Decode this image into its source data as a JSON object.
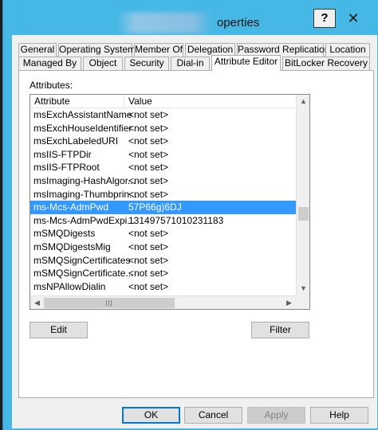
{
  "window": {
    "title_visible": "operties"
  },
  "tabs_row1": [
    "General",
    "Operating System",
    "Member Of",
    "Delegation",
    "Password Replication",
    "Location"
  ],
  "tabs_row2": [
    "Managed By",
    "Object",
    "Security",
    "Dial-in",
    "Attribute Editor",
    "BitLocker Recovery"
  ],
  "attributes_label": "Attributes:",
  "columns": {
    "attribute": "Attribute",
    "value": "Value"
  },
  "rows": [
    {
      "attr": "msExchAssistantName",
      "value": "<not set>"
    },
    {
      "attr": "msExchHouseIdentifier",
      "value": "<not set>"
    },
    {
      "attr": "msExchLabeledURI",
      "value": "<not set>"
    },
    {
      "attr": "msIIS-FTPDir",
      "value": "<not set>"
    },
    {
      "attr": "msIIS-FTPRoot",
      "value": "<not set>"
    },
    {
      "attr": "msImaging-HashAlgor...",
      "value": "<not set>"
    },
    {
      "attr": "msImaging-Thumbprin...",
      "value": "<not set>"
    },
    {
      "attr": "ms-Mcs-AdmPwd",
      "value": "57P66g)6DJ",
      "selected": true
    },
    {
      "attr": "ms-Mcs-AdmPwdExpi...",
      "value": "131497571010231183"
    },
    {
      "attr": "mSMQDigests",
      "value": "<not set>"
    },
    {
      "attr": "mSMQDigestsMig",
      "value": "<not set>"
    },
    {
      "attr": "mSMQSignCertificates",
      "value": "<not set>"
    },
    {
      "attr": "mSMQSignCertificate...",
      "value": "<not set>"
    },
    {
      "attr": "msNPAllowDialin",
      "value": "<not set>"
    }
  ],
  "buttons": {
    "edit": "Edit",
    "filter": "Filter",
    "ok": "OK",
    "cancel": "Cancel",
    "apply": "Apply",
    "help": "Help"
  },
  "glyphs": {
    "help": "?",
    "close": "✕",
    "up": "▲",
    "down": "▼",
    "left": "◀",
    "right": "▶",
    "grip": "|||"
  },
  "colors": {
    "title_bar": "#46b8e6",
    "selection": "#3399ff",
    "default_button_border": "#0078d7"
  }
}
